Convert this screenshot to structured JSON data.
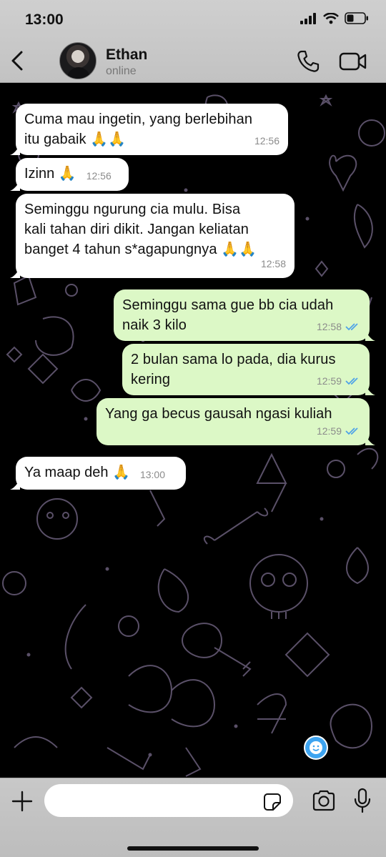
{
  "status_bar": {
    "time": "13:00"
  },
  "header": {
    "name": "Ethan",
    "status": "online"
  },
  "messages": [
    {
      "text": "Cuma mau ingetin, yang berlebihan\nitu gabaik 🙏🙏",
      "time": "12:56"
    },
    {
      "text": "Izinn 🙏",
      "time": "12:56"
    },
    {
      "text": "Seminggu ngurung cia mulu. Bisa\nkali tahan diri dikit. Jangan keliatan\nbanget 4 tahun s*agapungnya 🙏🙏",
      "time": "12:58"
    },
    {
      "text": "Seminggu sama gue bb cia udah\nnaik 3 kilo",
      "time": "12:58"
    },
    {
      "text": "2 bulan sama lo pada, dia kurus\nkering",
      "time": "12:59"
    },
    {
      "text": "Yang ga becus gausah ngasi kuliah",
      "time": "12:59"
    },
    {
      "text": "Ya maap deh 🙏",
      "time": "13:00"
    }
  ],
  "input": {
    "value": ""
  },
  "colors": {
    "incoming": "#ffffff",
    "outgoing": "#dcf8c6",
    "read_tick": "#4fa3e8",
    "wallpaper": "#000000"
  }
}
